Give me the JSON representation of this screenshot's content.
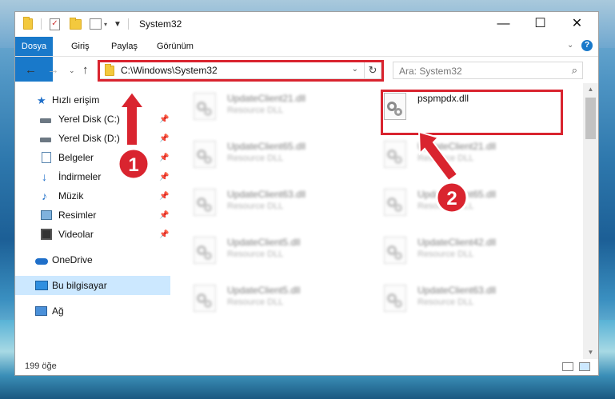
{
  "window": {
    "title": "System32",
    "controls": {
      "minimize": "—",
      "maximize": "☐",
      "close": "✕"
    }
  },
  "ribbon": {
    "tabs": [
      "Dosya",
      "Giriş",
      "Paylaş",
      "Görünüm"
    ]
  },
  "address": {
    "path": "C:\\Windows\\System32",
    "search_placeholder": "Ara: System32"
  },
  "nav": {
    "items": [
      {
        "label": "Hızlı erişim",
        "icon": "star-icon",
        "pinned": false
      },
      {
        "label": "Yerel Disk (C:)",
        "icon": "drive-icon",
        "pinned": true
      },
      {
        "label": "Yerel Disk (D:)",
        "icon": "drive-icon",
        "pinned": true
      },
      {
        "label": "Belgeler",
        "icon": "document-icon",
        "pinned": true
      },
      {
        "label": "İndirmeler",
        "icon": "download-icon",
        "pinned": true
      },
      {
        "label": "Müzik",
        "icon": "music-icon",
        "pinned": true
      },
      {
        "label": "Resimler",
        "icon": "pictures-icon",
        "pinned": true
      },
      {
        "label": "Videolar",
        "icon": "video-icon",
        "pinned": true
      },
      {
        "label": "OneDrive",
        "icon": "cloud-icon",
        "pinned": false
      },
      {
        "label": "Bu bilgisayar",
        "icon": "computer-icon",
        "pinned": false,
        "selected": true
      },
      {
        "label": "Ağ",
        "icon": "network-icon",
        "pinned": false
      }
    ]
  },
  "files": [
    {
      "name": "UpdateClient21.dll",
      "type": "Resource DLL"
    },
    {
      "name": "pspmpdx.dll",
      "type": "",
      "highlighted": true
    },
    {
      "name": "UpdateClient65.dll",
      "type": "Resource DLL"
    },
    {
      "name": "UpdateClient21.dll",
      "type": "Resource DLL"
    },
    {
      "name": "UpdateClient63.dll",
      "type": "Resource DLL"
    },
    {
      "name": "UpdateClient65.dll",
      "type": "Resource DLL"
    },
    {
      "name": "UpdateClient5.dll",
      "type": "Resource DLL"
    },
    {
      "name": "UpdateClient42.dll",
      "type": "Resource DLL"
    },
    {
      "name": "UpdateClient5.dll",
      "type": "Resource DLL"
    },
    {
      "name": "UpdateClient63.dll",
      "type": "Resource DLL"
    }
  ],
  "status": {
    "count": "199 öğe"
  },
  "annotations": {
    "step1": "1",
    "step2": "2",
    "color": "#d9242f"
  }
}
